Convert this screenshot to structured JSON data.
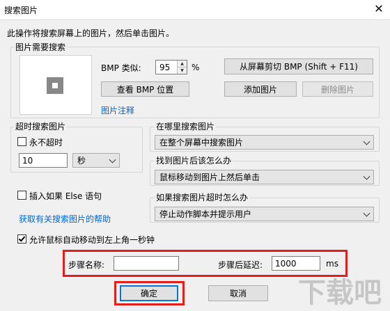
{
  "window": {
    "title": "搜索图片",
    "close_glyph": "✕"
  },
  "intro": "此操作将搜索屏幕上的图片，然后单击图片。",
  "search_image_group": {
    "legend": "图片需要搜索",
    "bmp_similarity_label": "BMP 类似:",
    "bmp_similarity_value": "95",
    "percent": "%",
    "capture_button": "从屏幕剪切 BMP (Shift + F11)",
    "view_bmp_button": "查看 BMP 位置",
    "add_image_button": "添加图片",
    "delete_image_button": "删除图片",
    "image_note_link": "图片注释"
  },
  "timeout_group": {
    "legend": "超时搜索图片",
    "never_timeout_label": "永不超时",
    "never_timeout_checked": false,
    "timeout_value": "10",
    "unit_select": "秒"
  },
  "where_group": {
    "legend": "在哪里搜索图片",
    "select": "在整个屏幕中搜索图片"
  },
  "found_group": {
    "legend": "找到图片后该怎么办",
    "select": "鼠标移动到图片上然后单击"
  },
  "else_checkbox": {
    "label": "插入如果 Else 语句",
    "checked": false
  },
  "help_link": "获取有关搜索图片的帮助",
  "timeout_action_group": {
    "legend": "如果搜索图片超时怎么办",
    "select": "停止动作脚本并提示用户"
  },
  "allow_mouse": {
    "label": "允许鼠标自动移动到左上角一秒钟",
    "checked": true
  },
  "step": {
    "name_label": "步骤名称:",
    "name_value": "",
    "delay_label": "步骤后延迟:",
    "delay_value": "1000",
    "delay_unit": "ms"
  },
  "footer": {
    "ok_button": "确定",
    "cancel_button": "取消"
  },
  "watermark": "下载吧"
}
